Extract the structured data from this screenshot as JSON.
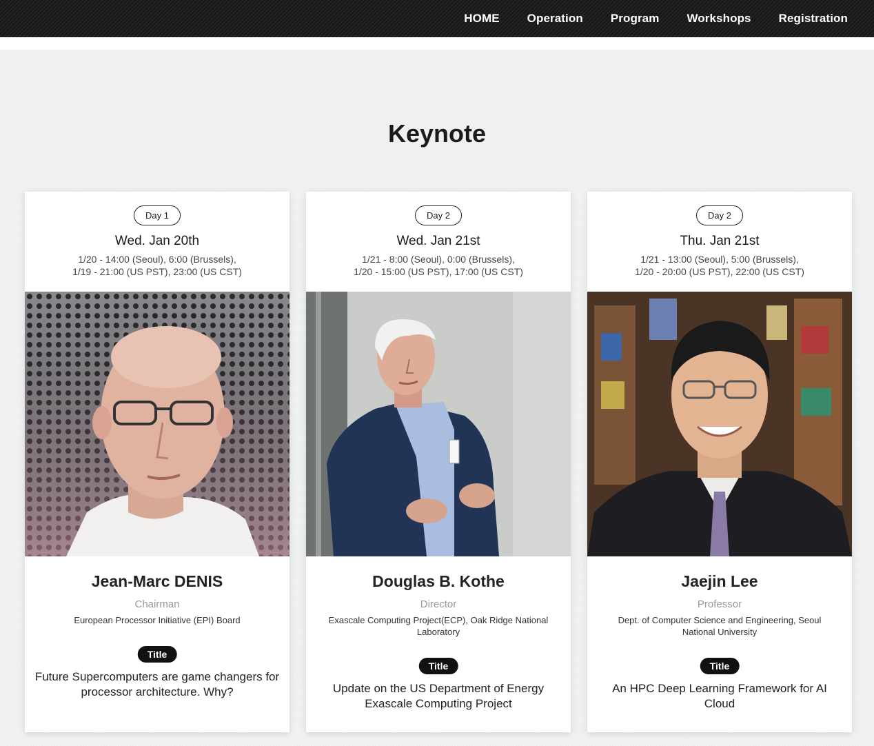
{
  "nav": {
    "items": [
      "HOME",
      "Operation",
      "Program",
      "Workshops",
      "Registration"
    ]
  },
  "section": {
    "title": "Keynote"
  },
  "speakers": [
    {
      "day": "Day 1",
      "date": "Wed. Jan 20th",
      "times": [
        "1/20 - 14:00 (Seoul), 6:00 (Brussels),",
        "1/19 - 21:00 (US PST), 23:00 (US CST)"
      ],
      "name": "Jean-Marc DENIS",
      "role": "Chairman",
      "org": "European Processor Initiative (EPI) Board",
      "title_label": "Title",
      "talk": "Future Supercomputers are game changers for processor architecture. Why?"
    },
    {
      "day": "Day 2",
      "date": "Wed. Jan 21st",
      "times": [
        "1/21 - 8:00 (Seoul), 0:00 (Brussels),",
        "1/20 - 15:00 (US PST), 17:00 (US CST)"
      ],
      "name": "Douglas B. Kothe",
      "role": "Director",
      "org": "Exascale Computing Project(ECP), Oak Ridge National Laboratory",
      "title_label": "Title",
      "talk": "Update on the US Department of Energy Exascale Computing Project"
    },
    {
      "day": "Day 2",
      "date": "Thu. Jan 21st",
      "times": [
        "1/21 - 13:00 (Seoul), 5:00 (Brussels),",
        "1/20 - 20:00 (US PST), 22:00 (US CST)"
      ],
      "name": "Jaejin Lee",
      "role": "Professor",
      "org": "Dept. of Computer Science and Engineering, Seoul National University",
      "title_label": "Title",
      "talk": "An HPC Deep Learning Framework for AI Cloud"
    }
  ]
}
